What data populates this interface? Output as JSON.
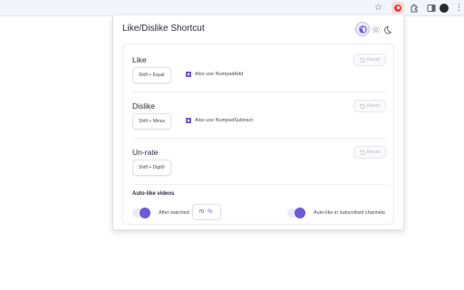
{
  "browser": {
    "icons": [
      "star-icon",
      "extension-active-icon",
      "puzzle-icon",
      "side-panel-icon",
      "avatar-icon",
      "more-vert-icon"
    ]
  },
  "popup": {
    "title": "Like/Dislike Shortcut",
    "theme_modes": [
      "auto",
      "light",
      "dark"
    ],
    "theme_selected": "auto"
  },
  "sections": {
    "like": {
      "title": "Like",
      "shortcut": "Shift + Equal",
      "reset_label": "Reset",
      "checkbox_label": "Also use NumpadAdd",
      "checked": true
    },
    "dislike": {
      "title": "Dislike",
      "shortcut": "Shift + Minus",
      "reset_label": "Reset",
      "checkbox_label": "Also use NumpadSubtract",
      "checked": true
    },
    "unrate": {
      "title": "Un-rate",
      "shortcut": "Shift + Digit0",
      "reset_label": "Reset"
    }
  },
  "auto_like": {
    "title": "Auto-like videos",
    "after_watched_label": "After watched",
    "after_watched_enabled": true,
    "percent_value": "70",
    "percent_unit": "%",
    "subscribed_label": "Auto-like in subscribed channels",
    "subscribed_enabled": true
  },
  "colors": {
    "accent": "#6b5bd6",
    "toggle_track": "#ece9fb",
    "toolbar": "#f2f5fb"
  }
}
